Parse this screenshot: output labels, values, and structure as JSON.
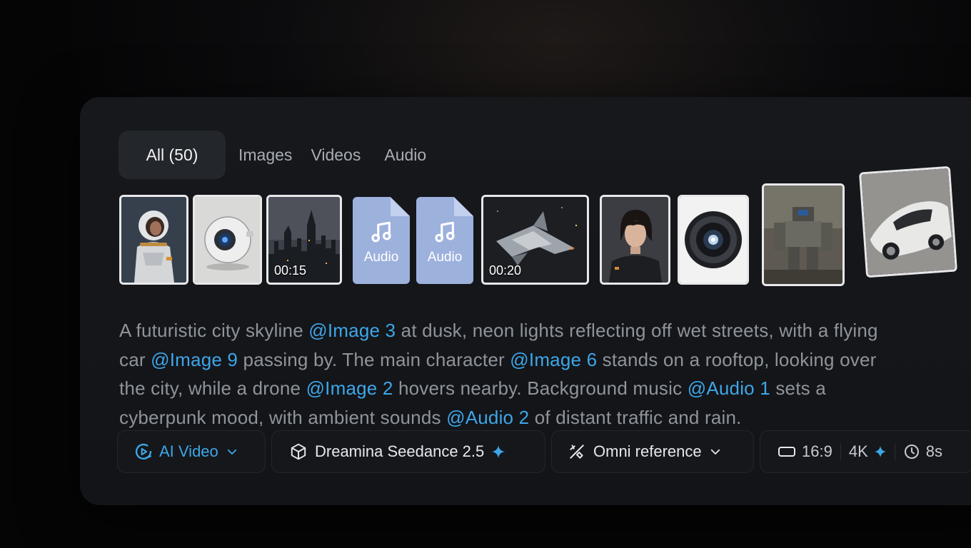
{
  "tabs": [
    {
      "label": "All (50)",
      "active": true
    },
    {
      "label": "Images"
    },
    {
      "label": "Videos"
    },
    {
      "label": "Audio"
    }
  ],
  "thumbnails": [
    {
      "type": "image",
      "subject": "astronaut in white spacesuit"
    },
    {
      "type": "image",
      "subject": "spherical white drone"
    },
    {
      "type": "video",
      "subject": "dark futuristic city skyline",
      "duration": "00:15"
    },
    {
      "type": "audio",
      "label": "Audio"
    },
    {
      "type": "audio",
      "label": "Audio"
    },
    {
      "type": "video",
      "subject": "spaceship in space",
      "duration": "00:20"
    },
    {
      "type": "image",
      "subject": "woman with short dark hair"
    },
    {
      "type": "image",
      "subject": "mechanical lens eye"
    },
    {
      "type": "image",
      "subject": "battle mech robot"
    },
    {
      "type": "image",
      "subject": "white futuristic car"
    }
  ],
  "prompt": {
    "line1": {
      "t1": "A futuristic city skyline ",
      "m1": "@Image 3",
      "t2": " at dusk, neon lights reflecting off wet streets, with a flying"
    },
    "line2": {
      "t1": "car ",
      "m1": "@Image 9",
      "t2": " passing by. The main character ",
      "m2": "@Image 6",
      "t3": " stands on a rooftop, looking over"
    },
    "line3": {
      "t1": "the city, while a drone ",
      "m1": "@Image 2",
      "t2": " hovers nearby. Background music ",
      "m2": "@Audio 1",
      "t3": " sets a"
    },
    "line4": {
      "t1": "cyberpunk mood, with ambient sounds ",
      "m1": "@Audio 2",
      "t2": " of distant traffic and rain."
    }
  },
  "toolbar": {
    "mode": "AI Video",
    "model": "Dreamina Seedance 2.5",
    "reference": "Omni reference",
    "aspect": "16:9",
    "resolution": "4K",
    "duration": "8s"
  },
  "colors": {
    "accent": "#3ea6e8",
    "panel": "#15171b",
    "audio_file": "#9db1dd"
  }
}
